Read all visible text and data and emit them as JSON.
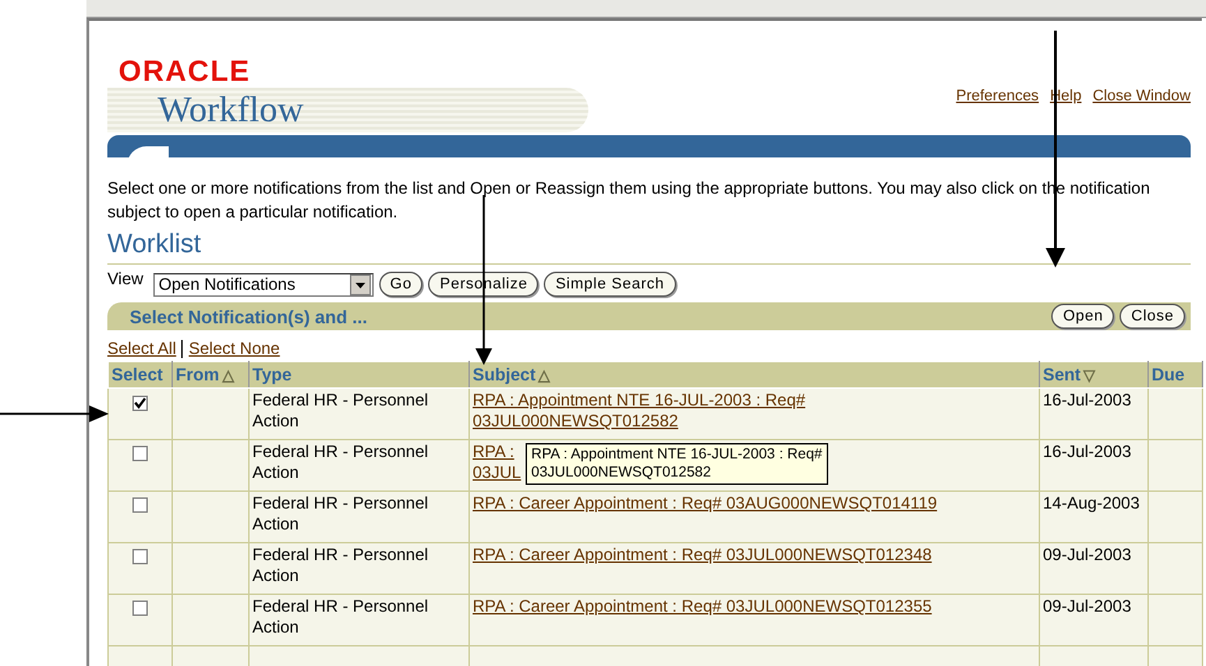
{
  "brand": {
    "company": "ORACLE",
    "product": "Workflow"
  },
  "global_links": [
    "Preferences",
    "Help",
    "Close Window"
  ],
  "instructions": "Select one or more notifications from the list and Open or Reassign them using the appropriate buttons. You may also click on the notification subject to open a particular notification.",
  "title": "Worklist",
  "view": {
    "label": "View",
    "value": "Open Notifications",
    "buttons": [
      "Go",
      "Personalize",
      "Simple Search"
    ]
  },
  "section": {
    "title": "Select Notification(s) and ...",
    "buttons": [
      "Open",
      "Close"
    ]
  },
  "select_links": [
    "Select All",
    "Select None"
  ],
  "table": {
    "columns": [
      {
        "label": "Select"
      },
      {
        "label": "From",
        "sort_mark": "△"
      },
      {
        "label": "Type"
      },
      {
        "label": "Subject",
        "sort_mark": "△"
      },
      {
        "label": "Sent",
        "sort_mark": "▽"
      },
      {
        "label": "Due"
      }
    ],
    "rows": [
      {
        "checked": true,
        "type": "Federal HR - Personnel Action",
        "subject": [
          "RPA : Appointment NTE 16-JUL-2003 : Req#",
          "03JUL000NEWSQT012582"
        ],
        "sent": "16-Jul-2003"
      },
      {
        "checked": false,
        "type": "Federal HR - Personnel Action",
        "subject": [
          "RPA :",
          "03JUL"
        ],
        "sent": "16-Jul-2003",
        "tooltip": [
          "RPA : Appointment NTE 16-JUL-2003 : Req#",
          "03JUL000NEWSQT012582"
        ]
      },
      {
        "checked": false,
        "type": "Federal HR - Personnel Action",
        "subject": [
          "RPA : Career Appointment : Req# 03AUG000NEWSQT014119"
        ],
        "sent": "14-Aug-2003"
      },
      {
        "checked": false,
        "type": "Federal HR - Personnel Action",
        "subject": [
          "RPA : Career Appointment : Req# 03JUL000NEWSQT012348"
        ],
        "sent": "09-Jul-2003"
      },
      {
        "checked": false,
        "type": "Federal HR - Personnel Action",
        "subject": [
          "RPA : Career Appointment : Req# 03JUL000NEWSQT012355"
        ],
        "sent": "09-Jul-2003"
      }
    ]
  }
}
